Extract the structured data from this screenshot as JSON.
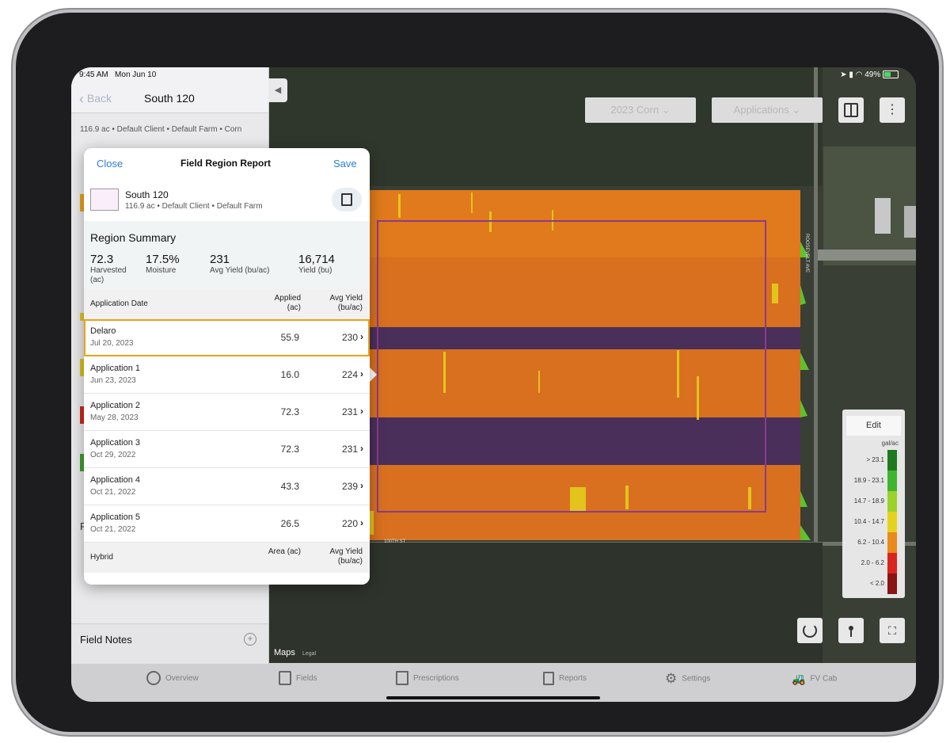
{
  "status": {
    "time": "9:45 AM",
    "date": "Mon Jun 10",
    "battery": "49%"
  },
  "sidebar": {
    "back_label": "Back",
    "title": "South 120",
    "meta": "116.9 ac • Default Client • Default Farm • Corn",
    "partial_label": "P",
    "field_notes_label": "Field Notes"
  },
  "map": {
    "season_label": "2023 Corn",
    "layer_label": "Applications",
    "road_east": "ROOSEVELT AVE",
    "road_south": "100TH ST",
    "maps_brand": "Maps",
    "maps_legal": "Legal"
  },
  "legend": {
    "edit_label": "Edit",
    "unit": "gal/ac",
    "rows": [
      {
        "label": "> 23.1",
        "color": "#1f7a1f"
      },
      {
        "label": "18.9 - 23.1",
        "color": "#3fb52f"
      },
      {
        "label": "14.7 - 18.9",
        "color": "#9bd12a"
      },
      {
        "label": "10.4 - 14.7",
        "color": "#e5d21d"
      },
      {
        "label": "6.2 - 10.4",
        "color": "#e98a1c"
      },
      {
        "label": "2.0 - 6.2",
        "color": "#d8261e"
      },
      {
        "label": "< 2.0",
        "color": "#8a1515"
      }
    ]
  },
  "popover": {
    "close_label": "Close",
    "title": "Field Region Report",
    "save_label": "Save",
    "field_name": "South 120",
    "field_meta": "116.9 ac • Default Client • Default Farm",
    "summary_title": "Region Summary",
    "stats": [
      {
        "value": "72.3",
        "label": "Harvested (ac)"
      },
      {
        "value": "17.5%",
        "label": "Moisture"
      },
      {
        "value": "231",
        "label": "Avg Yield (bu/ac)"
      },
      {
        "value": "16,714",
        "label": "Yield (bu)"
      }
    ],
    "app_header": {
      "col1": "Application Date",
      "col2": "Applied (ac)",
      "col3": "Avg Yield (bu/ac)"
    },
    "applications": [
      {
        "name": "Delaro",
        "date": "Jul 20, 2023",
        "applied": "55.9",
        "yield": "230"
      },
      {
        "name": "Application 1",
        "date": "Jun 23, 2023",
        "applied": "16.0",
        "yield": "224"
      },
      {
        "name": "Application 2",
        "date": "May 28, 2023",
        "applied": "72.3",
        "yield": "231"
      },
      {
        "name": "Application 3",
        "date": "Oct 29, 2022",
        "applied": "72.3",
        "yield": "231"
      },
      {
        "name": "Application 4",
        "date": "Oct 21, 2022",
        "applied": "43.3",
        "yield": "239"
      },
      {
        "name": "Application 5",
        "date": "Oct 21, 2022",
        "applied": "26.5",
        "yield": "220"
      }
    ],
    "hybrid_header": {
      "col1": "Hybrid",
      "col2": "Area (ac)",
      "col3": "Avg Yield (bu/ac)"
    }
  },
  "tabs": [
    {
      "label": "Overview",
      "icon": "overview-icon"
    },
    {
      "label": "Fields",
      "icon": "fields-icon"
    },
    {
      "label": "Prescriptions",
      "icon": "prescriptions-icon"
    },
    {
      "label": "Reports",
      "icon": "reports-icon"
    },
    {
      "label": "Settings",
      "icon": "gear-icon"
    },
    {
      "label": "FV Cab",
      "icon": "tractor-icon"
    }
  ]
}
